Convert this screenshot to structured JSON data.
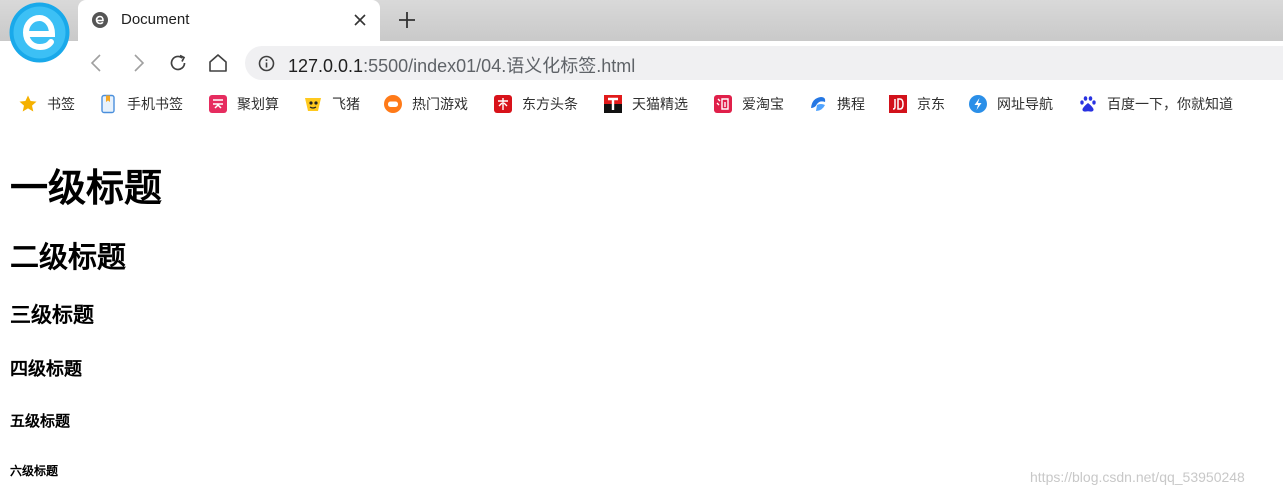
{
  "tab": {
    "title": "Document"
  },
  "address_bar": {
    "host": "127.0.0.1",
    "path": ":5500/index01/04.语义化标签.html"
  },
  "bookmarks": [
    {
      "label": "书签",
      "icon": "star-icon"
    },
    {
      "label": "手机书签",
      "icon": "mobile-bookmark-icon"
    },
    {
      "label": "聚划算",
      "icon": "juhuasuan-icon"
    },
    {
      "label": "飞猪",
      "icon": "fliggy-icon"
    },
    {
      "label": "热门游戏",
      "icon": "game-icon"
    },
    {
      "label": "东方头条",
      "icon": "dongfang-icon"
    },
    {
      "label": "天猫精选",
      "icon": "tmall-icon"
    },
    {
      "label": "爱淘宝",
      "icon": "taobao-icon"
    },
    {
      "label": "携程",
      "icon": "ctrip-icon"
    },
    {
      "label": "京东",
      "icon": "jd-icon"
    },
    {
      "label": "网址导航",
      "icon": "navigation-icon"
    },
    {
      "label": "百度一下，你就知道",
      "icon": "baidu-icon"
    }
  ],
  "page": {
    "h1": "一级标题",
    "h2": "二级标题",
    "h3": "三级标题",
    "h4": "四级标题",
    "h5": "五级标题",
    "h6": "六级标题"
  },
  "watermark": "https://blog.csdn.net/qq_53950248",
  "colors": {
    "tab_strip": "#d0d0d0",
    "omnibox": "#f0f0f2",
    "brand": "#1fa3e6"
  }
}
